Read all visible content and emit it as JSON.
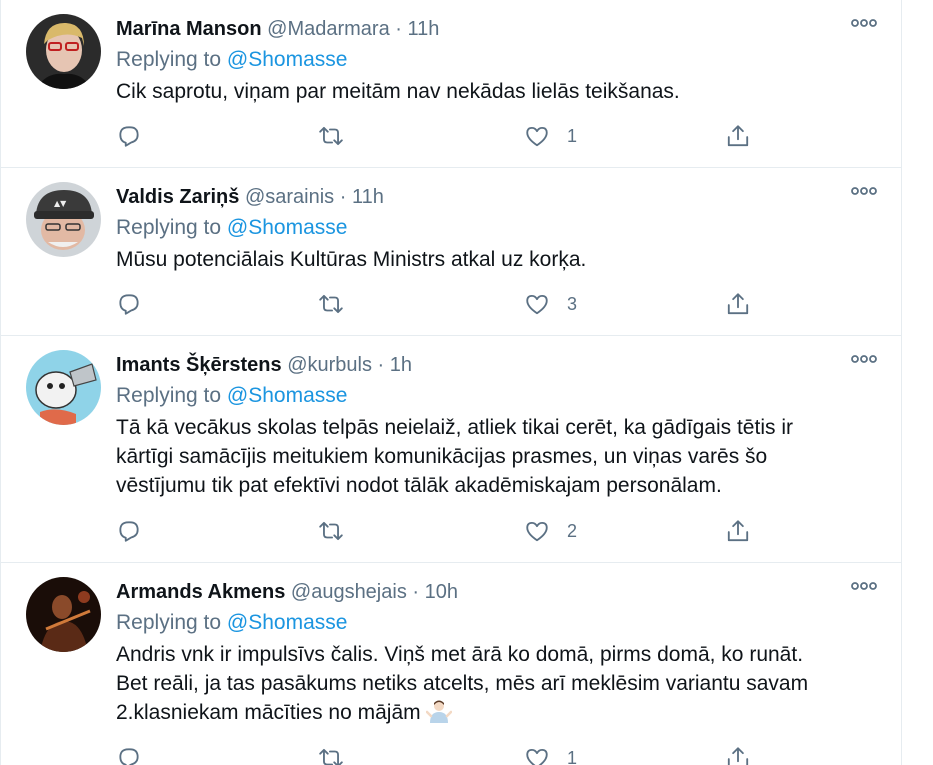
{
  "tweets": [
    {
      "name": "Marīna Manson",
      "handle": "@Madarmara",
      "separator": "·",
      "time": "11h",
      "replying_prefix": "Replying to ",
      "replying_to": "@Shomasse",
      "text_lines": [
        "Cik saprotu, viņam par meitām nav nekādas lielās teikšanas."
      ],
      "like_count": "1"
    },
    {
      "name": "Valdis Zariņš",
      "handle": "@sarainis",
      "separator": "·",
      "time": "11h",
      "replying_prefix": "Replying to ",
      "replying_to": "@Shomasse",
      "text_lines": [
        "Mūsu potenciālais Kultūras Ministrs atkal uz korķa."
      ],
      "like_count": "3"
    },
    {
      "name": "Imants Šķērstens",
      "handle": "@kurbuls",
      "separator": "·",
      "time": "1h",
      "replying_prefix": "Replying to ",
      "replying_to": "@Shomasse",
      "text_lines": [
        "Tā kā vecākus skolas telpās neielaiž, atliek tikai cerēt, ka gādīgais tētis ir",
        "kārtīgi samācījis meitukiem komunikācijas prasmes, un viņas varēs šo",
        "vēstījumu tik pat efektīvi nodot tālāk akadēmiskajam personālam."
      ],
      "like_count": "2"
    },
    {
      "name": "Armands Akmens",
      "handle": "@augshejais",
      "separator": "·",
      "time": "10h",
      "replying_prefix": "Replying to ",
      "replying_to": "@Shomasse",
      "text_lines": [
        "Andris vnk ir impulsīvs čalis. Viņš met ārā ko domā, pirms domā, ko runāt.",
        "Bet reāli, ja tas pasākums netiks atcelts, mēs arī meklēsim variantu savam",
        "2.klasniekam mācīties no mājām"
      ],
      "like_count": "1"
    }
  ],
  "icons": {
    "reply": "reply-icon",
    "retweet": "retweet-icon",
    "like": "heart-icon",
    "share": "share-icon",
    "more": "more-icon",
    "emoji": "man-shrugging-emoji"
  },
  "colors": {
    "link": "#1b95e0",
    "muted": "#5b7083",
    "text": "#0f1419",
    "border": "#e6ecf0"
  }
}
